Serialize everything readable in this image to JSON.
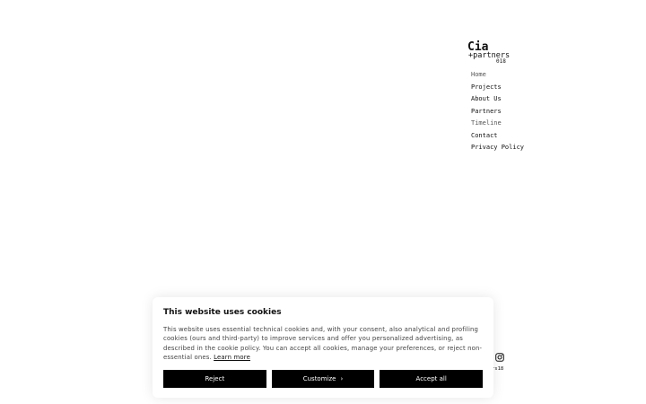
{
  "logo": {
    "line1": "Cia",
    "line2": "+partners",
    "line3": "018"
  },
  "nav": {
    "items": [
      {
        "label": "Home"
      },
      {
        "label": "Projects"
      },
      {
        "label": "About Us"
      },
      {
        "label": "Partners"
      },
      {
        "label": "Timeline"
      },
      {
        "label": "Contact"
      },
      {
        "label": "Privacy Policy"
      }
    ]
  },
  "footer": {
    "social_icon": "instagram-icon",
    "year_text": "rs18"
  },
  "cookie_banner": {
    "title": "This website uses cookies",
    "body": "This website uses essential technical cookies and, with your consent, also analytical and profiling cookies (ours and third-party) to improve services and offer you personalized advertising, as described in the cookie policy. You can accept all cookies, manage your preferences, or reject non-essential ones.",
    "learn_more": "Learn more",
    "reject_label": "Reject",
    "customize_label": "Customize",
    "customize_chevron": "›",
    "accept_label": "Accept all"
  },
  "colors": {
    "background": "#ffffff",
    "text": "#111111",
    "button_bg": "#000000",
    "button_text": "#ffffff"
  }
}
